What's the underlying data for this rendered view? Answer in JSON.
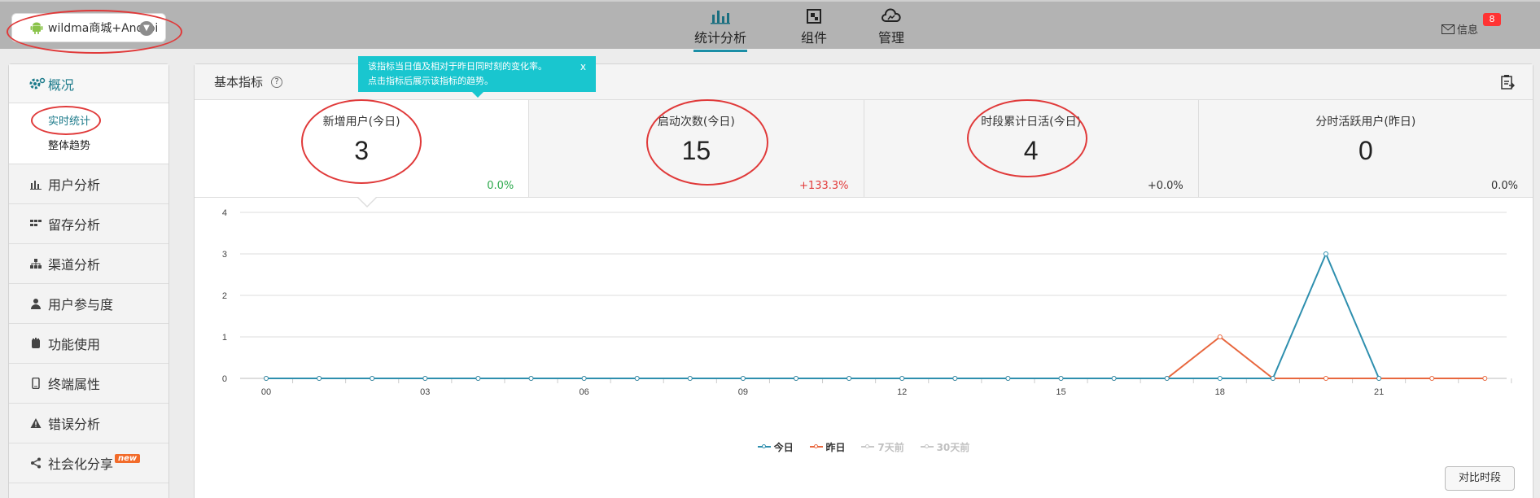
{
  "app_select": {
    "label": "wildma商城+Androi"
  },
  "nav": [
    {
      "label": "统计分析",
      "icon": "bar-chart-icon",
      "active": true
    },
    {
      "label": "组件",
      "icon": "component-icon",
      "active": false
    },
    {
      "label": "管理",
      "icon": "cloud-icon",
      "active": false
    }
  ],
  "messages": {
    "label": "信息",
    "count": "8"
  },
  "sidebar": {
    "header": "概况",
    "sub_items": [
      "实时统计",
      "整体趋势"
    ],
    "items": [
      {
        "label": "用户分析",
        "icon": "bar-chart-icon"
      },
      {
        "label": "留存分析",
        "icon": "grid-icon"
      },
      {
        "label": "渠道分析",
        "icon": "hierarchy-icon"
      },
      {
        "label": "用户参与度",
        "icon": "user-icon"
      },
      {
        "label": "功能使用",
        "icon": "hand-icon"
      },
      {
        "label": "终端属性",
        "icon": "phone-icon"
      },
      {
        "label": "错误分析",
        "icon": "warning-icon"
      },
      {
        "label": "社会化分享",
        "icon": "share-icon",
        "badge": "new"
      }
    ]
  },
  "panel": {
    "title": "基本指标",
    "tooltip_line1": "该指标当日值及相对于昨日同时刻的变化率。",
    "tooltip_line2": "点击指标后展示该指标的趋势。",
    "tooltip_close": "x",
    "metrics": [
      {
        "label": "新增用户(今日)",
        "value": "3",
        "change": "0.0%",
        "change_color": "#2aa84a"
      },
      {
        "label": "启动次数(今日)",
        "value": "15",
        "change": "+133.3%",
        "change_color": "#e23b3b"
      },
      {
        "label": "时段累计日活(今日)",
        "value": "4",
        "change": "+0.0%",
        "change_color": "#333333"
      },
      {
        "label": "分时活跃用户(昨日)",
        "value": "0",
        "change": "0.0%",
        "change_color": "#333333"
      }
    ],
    "compare_button": "对比时段"
  },
  "colors": {
    "today": "#2e8fae",
    "yesterday": "#e8673e",
    "inactive": "#c8c8c8",
    "accent": "#1b8ea6"
  },
  "chart_data": {
    "type": "line",
    "x": [
      0,
      1,
      2,
      3,
      4,
      5,
      6,
      7,
      8,
      9,
      10,
      11,
      12,
      13,
      14,
      15,
      16,
      17,
      18,
      19,
      20,
      21,
      22,
      23
    ],
    "x_tick_labels": [
      "00",
      "03",
      "06",
      "09",
      "12",
      "15",
      "18",
      "21"
    ],
    "x_tick_values": [
      0,
      3,
      6,
      9,
      12,
      15,
      18,
      21
    ],
    "y_ticks": [
      0,
      1,
      2,
      3,
      4
    ],
    "ylim": [
      0,
      4
    ],
    "grid": true,
    "legend_position": "bottom-center",
    "series": [
      {
        "name": "今日",
        "values": [
          0,
          0,
          0,
          0,
          0,
          0,
          0,
          0,
          0,
          0,
          0,
          0,
          0,
          0,
          0,
          0,
          0,
          0,
          0,
          0,
          3,
          0,
          null,
          null
        ]
      },
      {
        "name": "昨日",
        "values": [
          0,
          0,
          0,
          0,
          0,
          0,
          0,
          0,
          0,
          0,
          0,
          0,
          0,
          0,
          0,
          0,
          0,
          0,
          1,
          0,
          0,
          0,
          0,
          0
        ]
      },
      {
        "name": "7天前",
        "values": []
      },
      {
        "name": "30天前",
        "values": []
      }
    ]
  }
}
